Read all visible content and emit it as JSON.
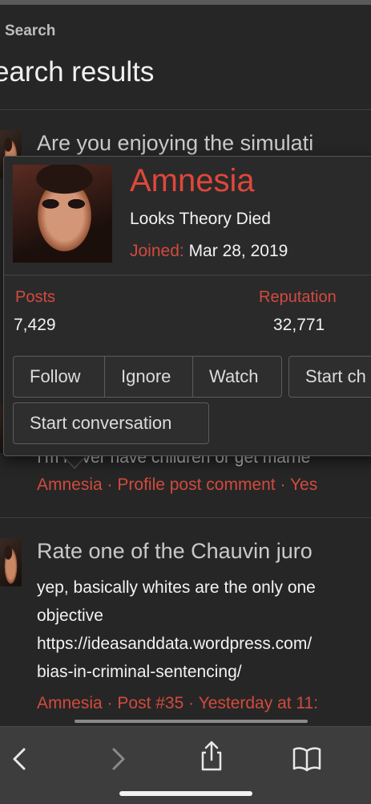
{
  "header": {
    "breadcrumb": "Search",
    "title": "earch results"
  },
  "results": [
    {
      "title": "Are you enjoying the simulati"
    },
    {
      "partial_text": "I'm never have children or get marrie",
      "meta": {
        "author": "Amnesia",
        "type": "Profile post comment",
        "date": "Yes"
      }
    },
    {
      "title": "Rate one of the Chauvin juro",
      "lines": [
        "yep, basically whites are the only one",
        "objective",
        "https://ideasanddata.wordpress.com/",
        "bias-in-criminal-sentencing/"
      ],
      "meta": {
        "author": "Amnesia",
        "type": "Post #35",
        "date": "Yesterday at 11:"
      }
    }
  ],
  "popup": {
    "name": "Amnesia",
    "user_title": "Looks Theory Died",
    "joined_label": "Joined:",
    "joined_date": "Mar 28, 2019",
    "stats": {
      "posts_label": "Posts",
      "posts_value": "7,429",
      "reputation_label": "Reputation",
      "reputation_value": "32,771"
    },
    "buttons": {
      "follow": "Follow",
      "ignore": "Ignore",
      "watch": "Watch",
      "start_chat": "Start ch",
      "start_conversation": "Start conversation"
    }
  },
  "separator": "·",
  "colors": {
    "accent": "#d24a3d",
    "background": "#262626",
    "popup_background": "#2a2a2a",
    "toolbar": "#3d3d3d"
  },
  "toolbar": {
    "icons": [
      "back-icon",
      "forward-icon",
      "share-icon",
      "bookmarks-icon"
    ]
  }
}
